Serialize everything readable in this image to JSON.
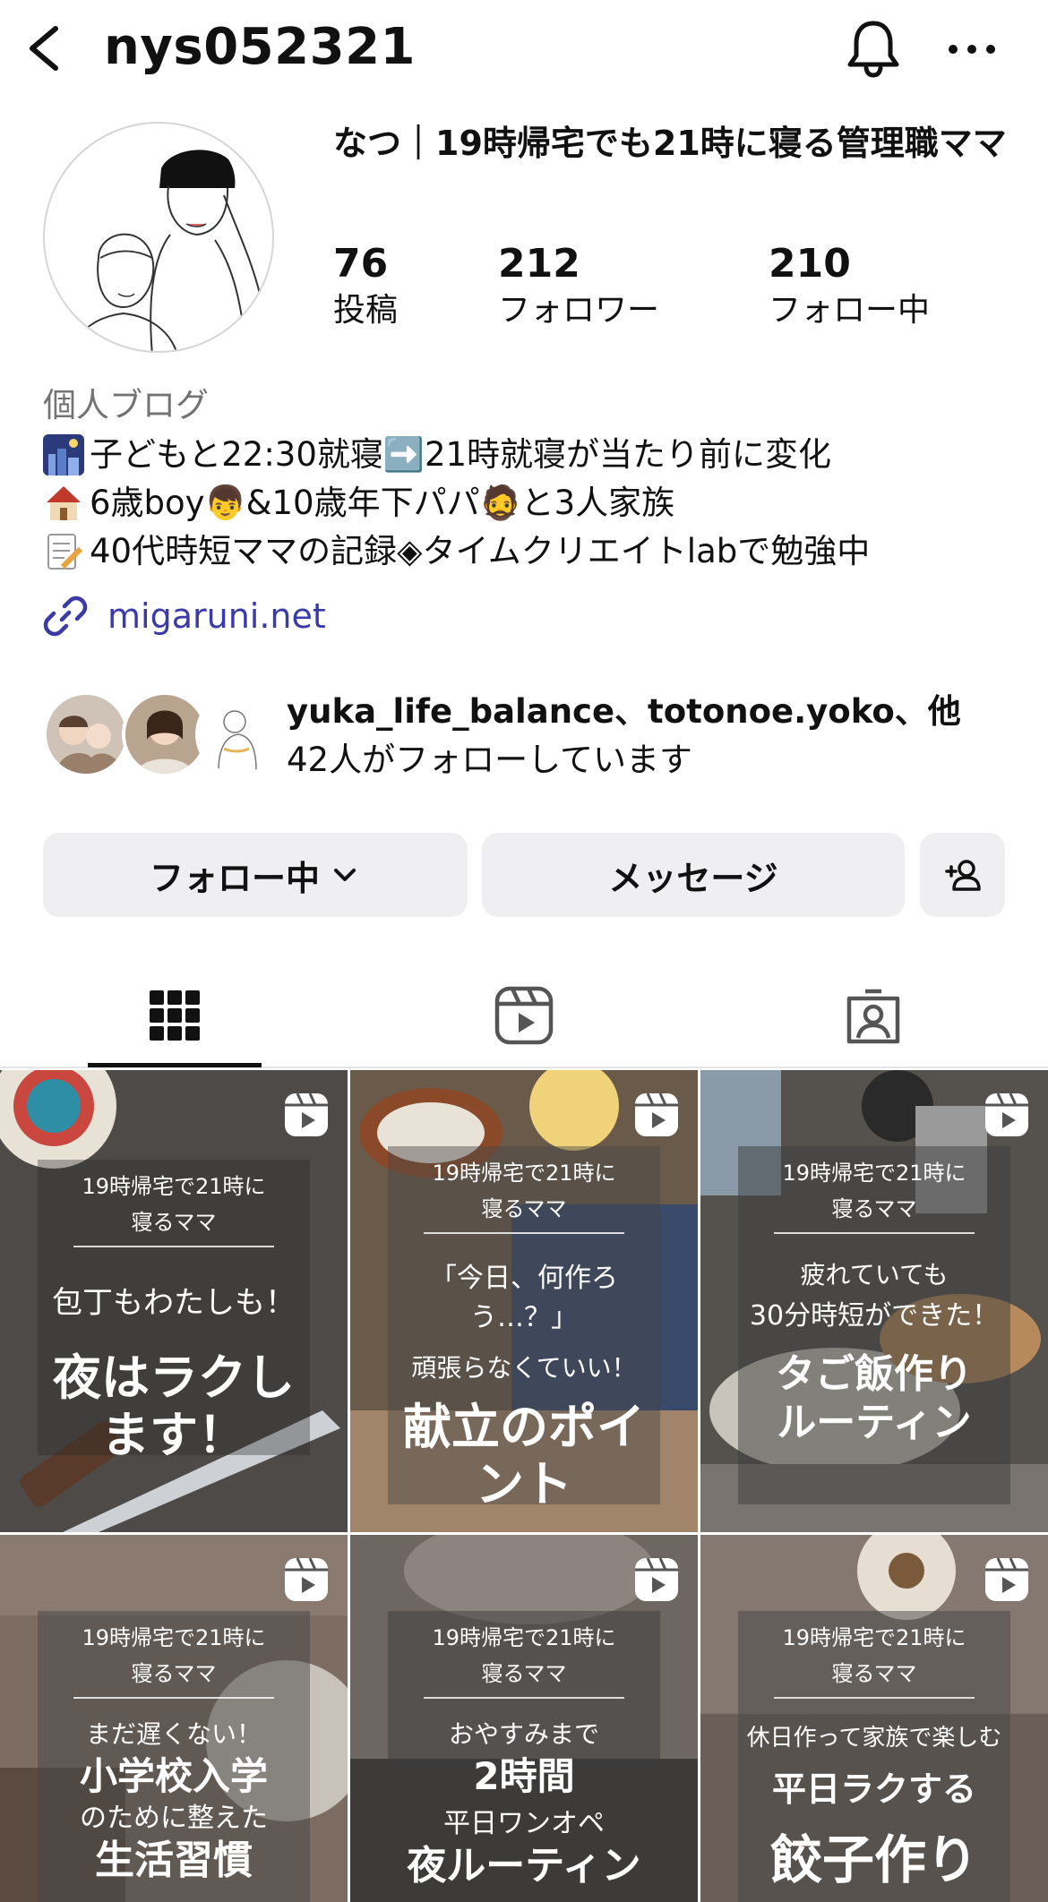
{
  "header": {
    "username": "nys052321"
  },
  "profile": {
    "display_name": "なつ｜19時帰宅でも21時に寝る管理職ママ",
    "stats": {
      "posts": {
        "value": "76",
        "label": "投稿"
      },
      "followers": {
        "value": "212",
        "label": "フォロワー"
      },
      "following": {
        "value": "210",
        "label": "フォロー中"
      }
    },
    "category": "個人ブログ",
    "bio": [
      {
        "icon": "night-city-emoji",
        "text": "子どもと22:30就寝➡️21時就寝が当たり前に変化"
      },
      {
        "icon": "house-emoji",
        "text": "6歳boy👦&10歳年下パパ🧔と3人家族"
      },
      {
        "icon": "memo-emoji",
        "text": "40代時短ママの記録◈タイムクリエイトlabで勉強中"
      }
    ],
    "link": "migaruni.net",
    "followed_by": {
      "names": "yuka_life_balance、totonoe.yoko、他",
      "count_text": "42人がフォローしています"
    }
  },
  "actions": {
    "following_label": "フォロー中",
    "message_label": "メッセージ"
  },
  "posts": [
    {
      "brand": "19時帰宅で21時に寝るママ",
      "lines": [
        "包丁もわたしも！",
        "夜はラクします！"
      ]
    },
    {
      "brand": "19時帰宅で21時に寝るママ",
      "lines": [
        "「今日、何作ろう…？」",
        "頑張らなくていい！",
        "献立のポイント"
      ]
    },
    {
      "brand": "19時帰宅で21時に寝るママ",
      "lines": [
        "疲れていても",
        "30分時短ができた！",
        "タご飯作り",
        "ルーティン"
      ]
    },
    {
      "brand": "19時帰宅で21時に寝るママ",
      "lines": [
        "まだ遅くない！",
        "小学校入学",
        "のために整えた",
        "生活習慣"
      ]
    },
    {
      "brand": "19時帰宅で21時に寝るママ",
      "lines": [
        "おやすみまで",
        "2時間",
        "平日ワンオペ",
        "夜ルーティン"
      ]
    },
    {
      "brand": "19時帰宅で21時に寝るママ",
      "lines": [
        "休日作って家族で楽しむ",
        "平日ラクする",
        "餃子作り"
      ]
    }
  ]
}
